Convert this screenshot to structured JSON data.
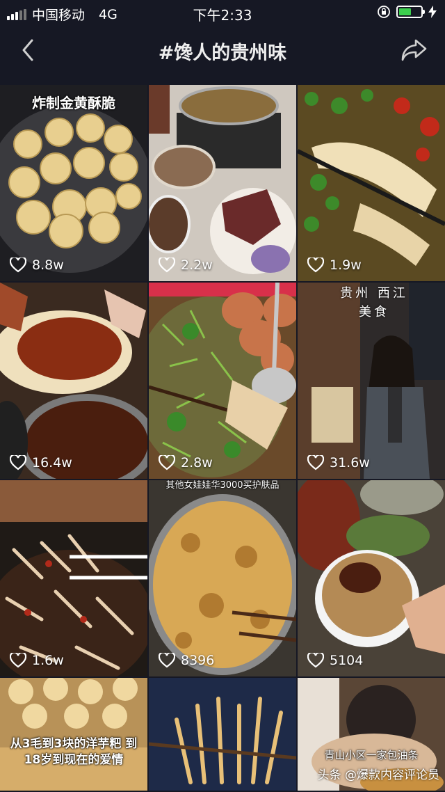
{
  "status_bar": {
    "carrier": "中国移动",
    "network": "4G",
    "time": "下午2:33",
    "battery_level": 0.55,
    "battery_color": "#3ccf4e"
  },
  "nav": {
    "title": "#馋人的贵州味",
    "back_icon": "chevron-left-icon",
    "share_icon": "share-arrow-icon"
  },
  "videos": [
    {
      "likes": "8.8w",
      "caption": "炸制金黄酥脆",
      "bg": "#2b2a2c"
    },
    {
      "likes": "2.2w",
      "caption": "",
      "bg": "#5a4a3d"
    },
    {
      "likes": "1.9w",
      "caption": "",
      "bg": "#6c5a2e"
    },
    {
      "likes": "16.4w",
      "caption": "",
      "bg": "#6b3a1e"
    },
    {
      "likes": "2.8w",
      "caption": "",
      "bg": "#4a5a2a"
    },
    {
      "likes": "31.6w",
      "caption": "贵州 西江美食",
      "bg": "#4a3a32"
    },
    {
      "likes": "1.6w",
      "caption": "",
      "bg": "#5b3a2a"
    },
    {
      "likes": "8396",
      "caption": "其他女娃娃华3000买护肤品",
      "bg": "#b6833c"
    },
    {
      "likes": "5104",
      "caption": "",
      "bg": "#6a5a4a"
    },
    {
      "likes": "",
      "caption": "从3毛到3块的洋芋粑 到18岁到现在的爱情",
      "bg": "#c9a25a"
    },
    {
      "likes": "",
      "caption": "",
      "bg": "#2a3550"
    },
    {
      "likes": "",
      "caption": "青山小区一家包油条",
      "bg": "#7a5a44"
    }
  ],
  "watermark": "头条 @爆款内容评论员"
}
